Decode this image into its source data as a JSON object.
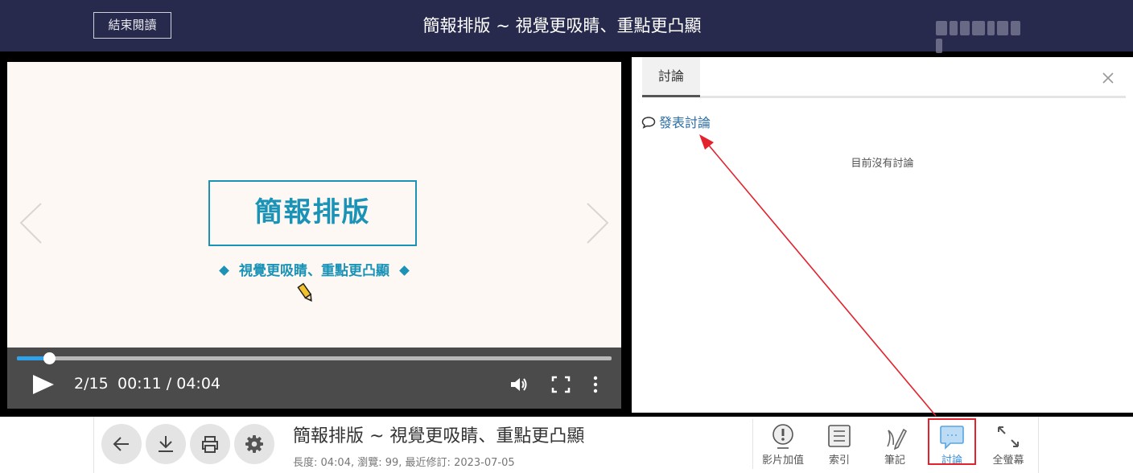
{
  "header": {
    "exit_label": "結束閱讀",
    "title": "簡報排版 ~ 視覺更吸睛、重點更凸顯",
    "user_name_redacted": ""
  },
  "slide": {
    "heading": "簡報排版",
    "subheading": "視覺更吸睛、重點更凸顯"
  },
  "player": {
    "page_indicator": "2/15",
    "time": "00:11 / 04:04",
    "progress": 0.054
  },
  "discussion": {
    "tab_label": "討論",
    "post_label": "發表討論",
    "empty_text": "目前沒有討論"
  },
  "info": {
    "title": "簡報排版 ~ 視覺更吸睛、重點更凸顯",
    "meta": "長度: 04:04, 瀏覽: 99, 最近修訂: 2023-07-05"
  },
  "tools": [
    {
      "label": "影片加值",
      "icon": "alert-circle-icon"
    },
    {
      "label": "索引",
      "icon": "list-icon"
    },
    {
      "label": "筆記",
      "icon": "pen-icon"
    },
    {
      "label": "討論",
      "icon": "chat-bubble-icon"
    },
    {
      "label": "全螢幕",
      "icon": "expand-icon"
    }
  ],
  "colors": {
    "header_bg": "#272a4c",
    "accent": "#1a93b7",
    "link": "#2b6ea6",
    "progress": "#2ea2ea",
    "annotation": "#e3222c"
  }
}
